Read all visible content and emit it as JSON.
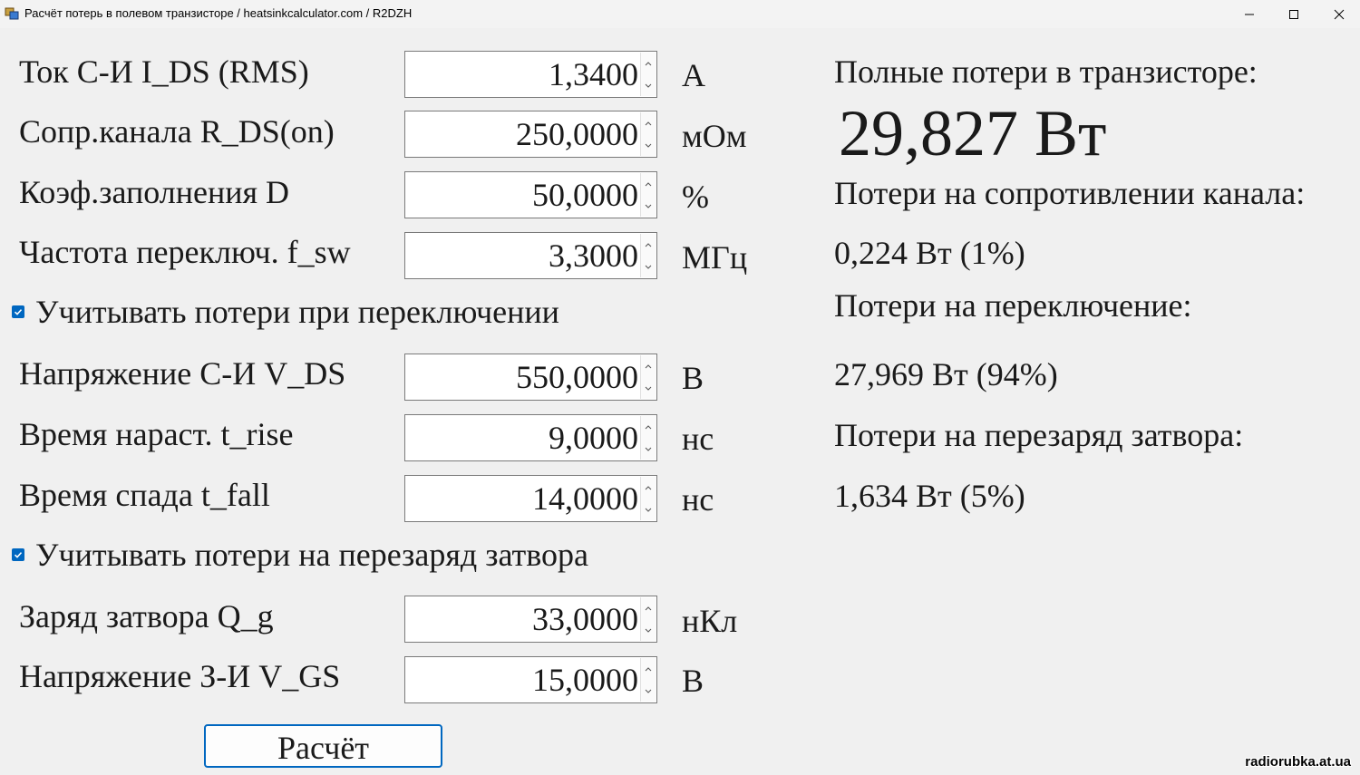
{
  "window": {
    "title": "Расчёт потерь в полевом транзисторе / heatsinkcalculator.com / R2DZH"
  },
  "inputs": [
    {
      "label": "Ток С-И I_DS (RMS)",
      "value": "1,3400",
      "unit": "А"
    },
    {
      "label": "Сопр.канала R_DS(on)",
      "value": "250,0000",
      "unit": "мОм"
    },
    {
      "label": "Коэф.заполнения  D",
      "value": "50,0000",
      "unit": "%"
    },
    {
      "label": "Частота переключ. f_sw",
      "value": "3,3000",
      "unit": "МГц"
    },
    {
      "label": "Напряжение С-И V_DS",
      "value": "550,0000",
      "unit": "В"
    },
    {
      "label": "Время нараст. t_rise",
      "value": "9,0000",
      "unit": "нс"
    },
    {
      "label": "Время спада t_fall",
      "value": "14,0000",
      "unit": "нс"
    },
    {
      "label": "Заряд затвора Q_g",
      "value": "33,0000",
      "unit": "нКл"
    },
    {
      "label": "Напряжение З-И V_GS",
      "value": "15,0000",
      "unit": "В"
    }
  ],
  "checkboxes": {
    "switching": {
      "label": "Учитывать потери при переключении",
      "checked": true
    },
    "gate": {
      "label": "Учитывать потери на перезаряд затвора",
      "checked": true
    }
  },
  "button": {
    "label": "Расчёт"
  },
  "results": {
    "total_label": "Полные потери в транзисторе:",
    "total_value": "29,827 Вт",
    "conduction_label": "Потери на сопротивлении канала:",
    "conduction_value": "0,224 Вт (1%)",
    "switching_label": "Потери на переключение:",
    "switching_value": "27,969 Вт (94%)",
    "gate_label": "Потери на перезаряд затвора:",
    "gate_value": "1,634 Вт (5%)"
  },
  "watermark": "radiorubka.at.ua",
  "colors": {
    "accent": "#0067c0",
    "background": "#f0f0f0"
  }
}
